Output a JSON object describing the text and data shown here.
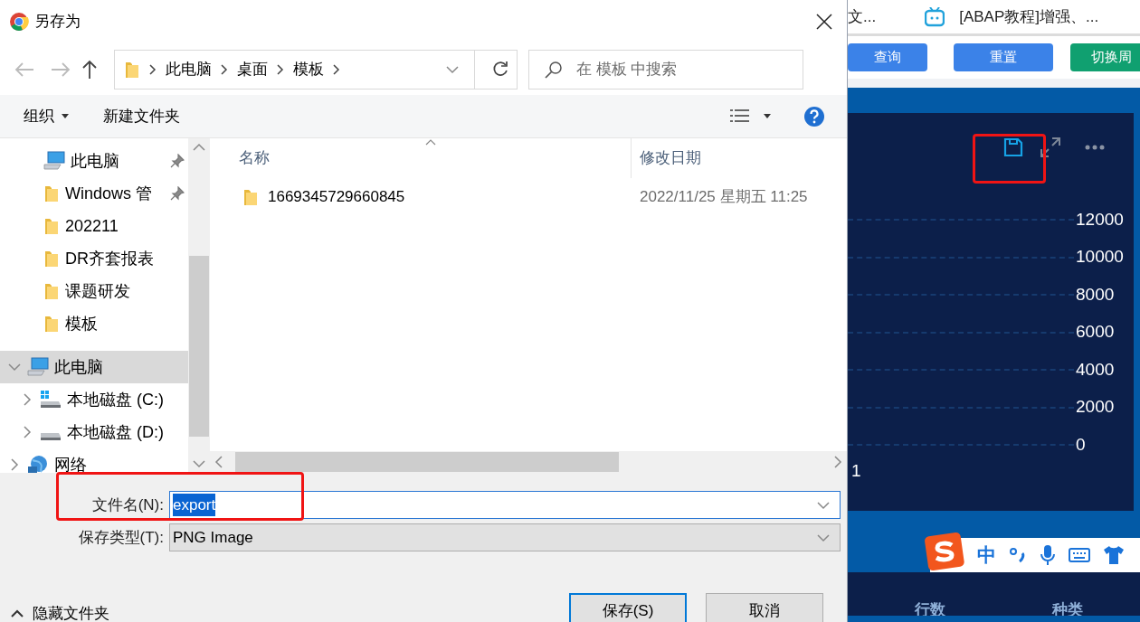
{
  "dialog": {
    "title": "另存为",
    "address": [
      "此电脑",
      "桌面",
      "模板"
    ],
    "search": {
      "placeholder": "在 模板 中搜索"
    },
    "toolbar": {
      "organize": "组织",
      "new_folder": "新建文件夹"
    },
    "quick_access": [
      {
        "label": "此电脑",
        "kind": "pc",
        "pinned": true
      },
      {
        "label": "Windows 管",
        "kind": "folder",
        "pinned": true
      },
      {
        "label": "202211",
        "kind": "folder",
        "pinned": false
      },
      {
        "label": "DR齐套报表",
        "kind": "folder",
        "pinned": false
      },
      {
        "label": "课题研发",
        "kind": "folder",
        "pinned": false
      },
      {
        "label": "模板",
        "kind": "folder",
        "pinned": false
      }
    ],
    "tree": [
      {
        "label": "此电脑",
        "kind": "pc",
        "expanded": true,
        "selected": true,
        "children": [
          {
            "label": "本地磁盘 (C:)",
            "kind": "system_drive",
            "expanded": false,
            "selected": false
          },
          {
            "label": "本地磁盘 (D:)",
            "kind": "drive",
            "expanded": false,
            "selected": false
          }
        ]
      },
      {
        "label": "网络",
        "kind": "network",
        "expanded": false,
        "selected": false
      }
    ],
    "columns": [
      "名称",
      "修改日期"
    ],
    "files": [
      {
        "name": "1669345729660845",
        "modified": "2022/11/25 星期五 11:25",
        "kind": "folder"
      }
    ],
    "file_name": {
      "label": "文件名(N):",
      "value": "export",
      "text_selected": true
    },
    "file_type": {
      "label": "保存类型(T):",
      "value": "PNG Image"
    },
    "hide_folders": "隐藏文件夹",
    "buttons": [
      {
        "label": "保存(S)",
        "default": true
      },
      {
        "label": "取消",
        "default": false
      }
    ]
  },
  "background_page": {
    "tabs": [
      {
        "title": "文..."
      },
      {
        "title": "[ABAP教程]增强、..."
      }
    ],
    "buttons": [
      {
        "label": "查询",
        "color": "#3b82e8"
      },
      {
        "label": "重置",
        "color": "#3b82e8"
      },
      {
        "label": "切换周",
        "color": "#10a070"
      }
    ],
    "chart": {
      "y_ticks": [
        "12000",
        "10000",
        "8000",
        "6000",
        "4000",
        "2000",
        "0"
      ],
      "x_label": "1"
    },
    "ime": {
      "mode": "中"
    },
    "table_headers": [
      "行数",
      "种类"
    ]
  }
}
